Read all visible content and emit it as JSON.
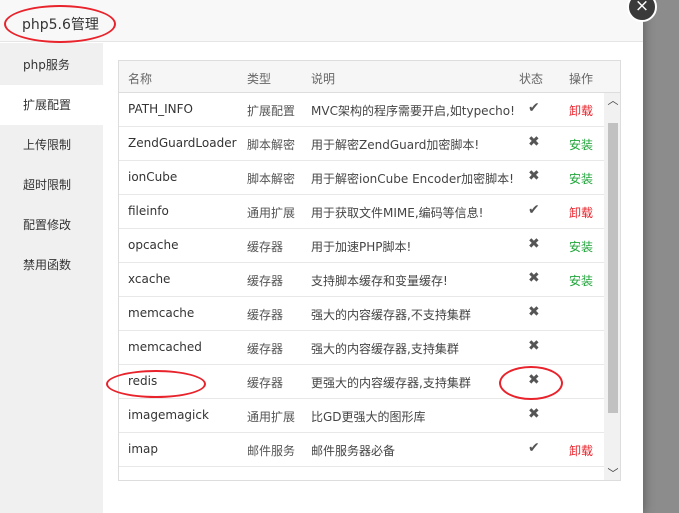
{
  "dialog": {
    "title": "php5.6管理",
    "close_glyph": "×"
  },
  "sidebar": {
    "items": [
      {
        "label": "php服务"
      },
      {
        "label": "扩展配置",
        "active": true
      },
      {
        "label": "上传限制"
      },
      {
        "label": "超时限制"
      },
      {
        "label": "配置修改"
      },
      {
        "label": "禁用函数"
      }
    ]
  },
  "table": {
    "headers": {
      "name": "名称",
      "type": "类型",
      "desc": "说明",
      "status": "状态",
      "op": "操作"
    },
    "rows": [
      {
        "name": "PATH_INFO",
        "type": "扩展配置",
        "desc": "MVC架构的程序需要开启,如typecho!",
        "status": "✔",
        "op": "卸载"
      },
      {
        "name": "ZendGuardLoader",
        "type": "脚本解密",
        "desc": "用于解密ZendGuard加密脚本!",
        "status": "✖",
        "op": "安装"
      },
      {
        "name": "ionCube",
        "type": "脚本解密",
        "desc": "用于解密ionCube Encoder加密脚本!",
        "status": "✖",
        "op": "安装"
      },
      {
        "name": "fileinfo",
        "type": "通用扩展",
        "desc": "用于获取文件MIME,编码等信息!",
        "status": "✔",
        "op": "卸载"
      },
      {
        "name": "opcache",
        "type": "缓存器",
        "desc": "用于加速PHP脚本!",
        "status": "✖",
        "op": "安装"
      },
      {
        "name": "xcache",
        "type": "缓存器",
        "desc": "支持脚本缓存和变量缓存!",
        "status": "✖",
        "op": "安装"
      },
      {
        "name": "memcache",
        "type": "缓存器",
        "desc": "强大的内容缓存器,不支持集群",
        "status": "✖",
        "op": ""
      },
      {
        "name": "memcached",
        "type": "缓存器",
        "desc": "强大的内容缓存器,支持集群",
        "status": "✖",
        "op": ""
      },
      {
        "name": "redis",
        "type": "缓存器",
        "desc": "更强大的内容缓存器,支持集群",
        "status": "✖",
        "op": ""
      },
      {
        "name": "imagemagick",
        "type": "通用扩展",
        "desc": "比GD更强大的图形库",
        "status": "✖",
        "op": ""
      },
      {
        "name": "imap",
        "type": "邮件服务",
        "desc": "邮件服务器必备",
        "status": "✔",
        "op": "卸载"
      }
    ]
  },
  "scrollbar": {
    "up_glyph": "︿",
    "down_glyph": "﹀"
  },
  "colors": {
    "install": "#20a53a",
    "uninstall": "#e8232b",
    "annotation": "#e8232b"
  }
}
